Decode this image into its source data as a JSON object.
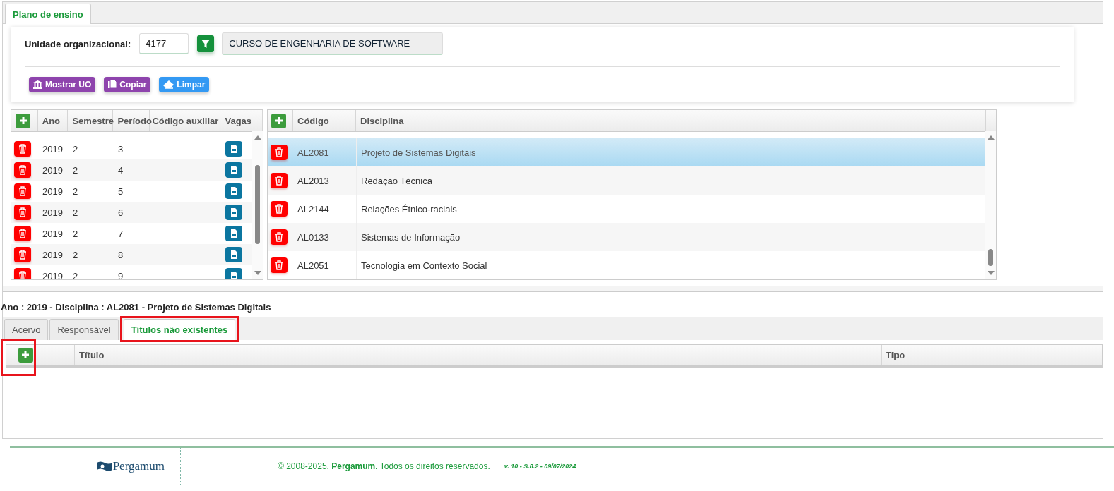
{
  "tab": {
    "label": "Plano de ensino",
    "selected": true
  },
  "filter": {
    "label": "Unidade organizacional:",
    "code": "4177",
    "name": "CURSO DE ENGENHARIA DE SOFTWARE"
  },
  "actions": [
    {
      "label": "Mostrar UO",
      "kind": "show"
    },
    {
      "label": "Copiar",
      "kind": "copy"
    },
    {
      "label": "Limpar",
      "kind": "clear"
    }
  ],
  "periods": {
    "columns": [
      "Ano",
      "Semestre",
      "Período",
      "Código auxiliar",
      "Vagas"
    ],
    "rows": [
      {
        "ano": "2019",
        "semestre": "2",
        "periodo": "3"
      },
      {
        "ano": "2019",
        "semestre": "2",
        "periodo": "4"
      },
      {
        "ano": "2019",
        "semestre": "2",
        "periodo": "5"
      },
      {
        "ano": "2019",
        "semestre": "2",
        "periodo": "6"
      },
      {
        "ano": "2019",
        "semestre": "2",
        "periodo": "7"
      },
      {
        "ano": "2019",
        "semestre": "2",
        "periodo": "8"
      },
      {
        "ano": "2019",
        "semestre": "2",
        "periodo": "9"
      }
    ]
  },
  "disciplines": {
    "columns": [
      "Código",
      "Disciplina"
    ],
    "rows": [
      {
        "code": "AL2081",
        "name": "Projeto de Sistemas Digitais",
        "selected": true
      },
      {
        "code": "AL2013",
        "name": "Redação Técnica",
        "selected": false
      },
      {
        "code": "AL2144",
        "name": "Relações Étnico-raciais",
        "selected": false
      },
      {
        "code": "AL0133",
        "name": "Sistemas de Informação",
        "selected": false
      },
      {
        "code": "AL2051",
        "name": "Tecnologia em Contexto Social",
        "selected": false
      }
    ]
  },
  "detail_title": "Ano : 2019 - Disciplina : AL2081 - Projeto de Sistemas Digitais",
  "detail_tabs": [
    {
      "label": "Acervo",
      "selected": false,
      "highlighted": false
    },
    {
      "label": "Responsável",
      "selected": false,
      "highlighted": false
    },
    {
      "label": "Títulos não existentes",
      "selected": true,
      "highlighted": true
    }
  ],
  "titles": {
    "columns": [
      "Título",
      "Tipo"
    ],
    "add_highlighted": true
  },
  "footer": {
    "logo": "Pergamum",
    "copyright": "© 2008-2025. **Pergamum.** Todos os direitos reservados.",
    "version": "v. 10 - S.8.2 - 09/07/2024"
  }
}
